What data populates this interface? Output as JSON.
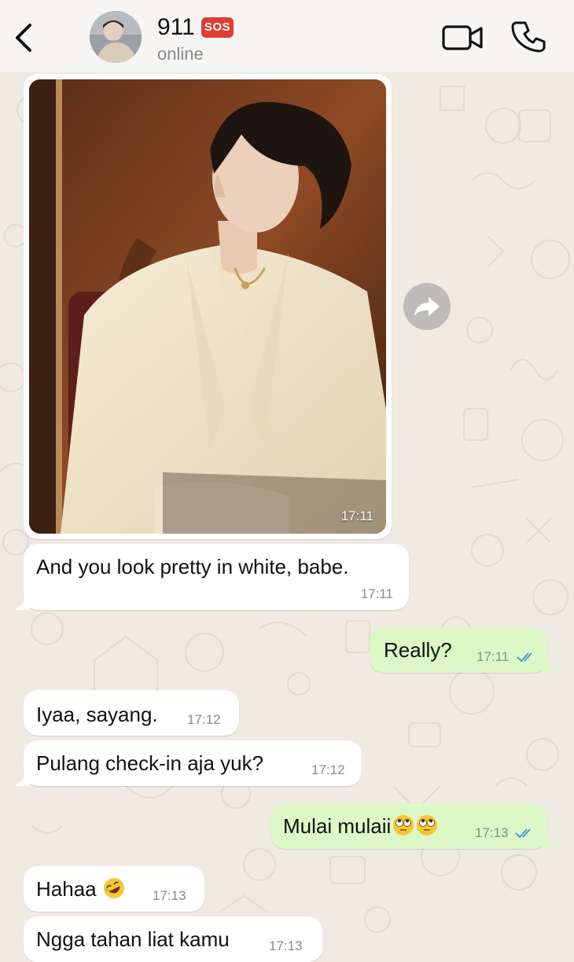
{
  "header": {
    "contact_name": "911",
    "badge": "SOS",
    "status": "online",
    "back_icon": "chevron-left-icon",
    "video_icon": "video-camera-icon",
    "call_icon": "phone-icon"
  },
  "colors": {
    "background": "#efeae2",
    "incoming_bubble": "#ffffff",
    "outgoing_bubble": "#dcf8c6",
    "read_ticks": "#4a9bd8",
    "sos_badge": "#e03b34"
  },
  "messages": [
    {
      "direction": "in",
      "type": "image",
      "time": "17:11"
    },
    {
      "direction": "in",
      "text": "And you look pretty in white, babe.",
      "time": "17:11"
    },
    {
      "direction": "out",
      "text": "Really?",
      "time": "17:11",
      "status": "read"
    },
    {
      "direction": "in",
      "text": "Iyaa, sayang.",
      "time": "17:12"
    },
    {
      "direction": "in",
      "text": "Pulang check-in aja yuk?",
      "time": "17:12"
    },
    {
      "direction": "out",
      "text": "Mulai mulaii",
      "emoji": [
        "face-with-rolling-eyes",
        "face-with-rolling-eyes"
      ],
      "time": "17:13",
      "status": "read"
    },
    {
      "direction": "in",
      "text": "Hahaa",
      "emoji": [
        "rolling-on-the-floor-laughing"
      ],
      "time": "17:13"
    },
    {
      "direction": "in",
      "text": "Ngga tahan liat kamu",
      "time": "17:13"
    }
  ]
}
